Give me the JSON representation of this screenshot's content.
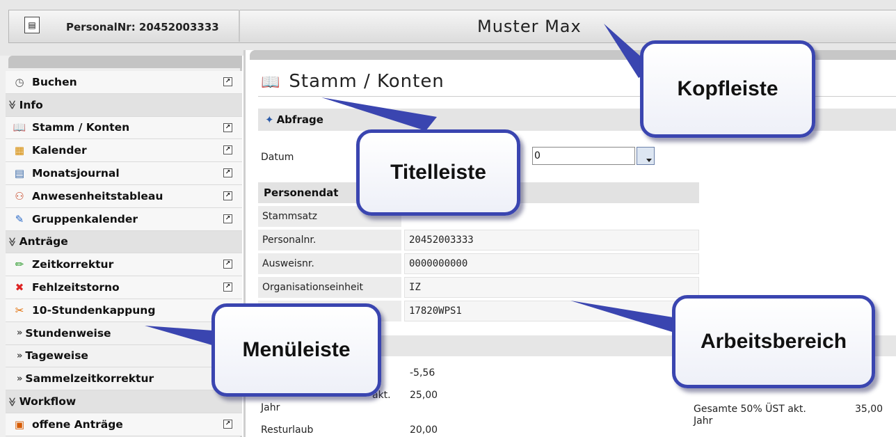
{
  "header": {
    "personal_nr": "PersonalNr: 20452003333",
    "user_name": "Muster Max"
  },
  "sidebar": {
    "items": [
      {
        "type": "item",
        "label": "Buchen",
        "icon": "clock-icon",
        "open": true
      },
      {
        "type": "head",
        "label": "Info"
      },
      {
        "type": "item",
        "label": "Stamm / Konten",
        "icon": "book-icon",
        "open": true
      },
      {
        "type": "item",
        "label": "Kalender",
        "icon": "calendar-icon",
        "open": true
      },
      {
        "type": "item",
        "label": "Monatsjournal",
        "icon": "journal-icon",
        "open": true
      },
      {
        "type": "item",
        "label": "Anwesenheitstableau",
        "icon": "people-icon",
        "open": true
      },
      {
        "type": "item",
        "label": "Gruppenkalender",
        "icon": "group-calendar-icon",
        "open": true
      },
      {
        "type": "head",
        "label": "Anträge"
      },
      {
        "type": "item",
        "label": "Zeitkorrektur",
        "icon": "pencil-icon",
        "open": true
      },
      {
        "type": "item",
        "label": "Fehlzeitstorno",
        "icon": "cancel-icon",
        "open": true
      },
      {
        "type": "item",
        "label": "10-Stundenkappung",
        "icon": "scissors-icon",
        "open": false
      },
      {
        "type": "sub",
        "label": "Stundenweise"
      },
      {
        "type": "sub",
        "label": "Tageweise"
      },
      {
        "type": "sub",
        "label": "Sammelzeitkorrektur"
      },
      {
        "type": "head",
        "label": "Workflow"
      },
      {
        "type": "item",
        "label": "offene Anträge",
        "icon": "pending-icon",
        "open": true
      }
    ]
  },
  "main": {
    "title": "Stamm / Konten",
    "section": "Abfrage",
    "datum_label": "Datum",
    "datum_value": "0",
    "personendaten_head": "Personendat",
    "rows": [
      {
        "label": "Stammsatz",
        "value": ""
      },
      {
        "label": "Personalnr.",
        "value": "20452003333"
      },
      {
        "label": "Ausweisnr.",
        "value": "0000000000"
      },
      {
        "label": "Organisationseinheit",
        "value": "IZ"
      },
      {
        "label": "",
        "value": "17820WPS1"
      }
    ],
    "value_neg": "-5,56",
    "label_akt": "akt.",
    "label_jahr": "Jahr",
    "value_akt": "25,00",
    "label_resturlaub": "Resturlaub",
    "value_resturlaub": "20,00",
    "ust_label": "Gesamte 50% ÜST akt.",
    "ust_label2": "Jahr",
    "ust_value": "35,00"
  },
  "callouts": {
    "kopfleiste": "Kopfleiste",
    "titelleiste": "Titelleiste",
    "menueleiste": "Menüleiste",
    "arbeitsbereich": "Arbeitsbereich"
  },
  "colors": {
    "callout_border": "#3a45b0",
    "accent_blue": "#3a6aa8"
  }
}
